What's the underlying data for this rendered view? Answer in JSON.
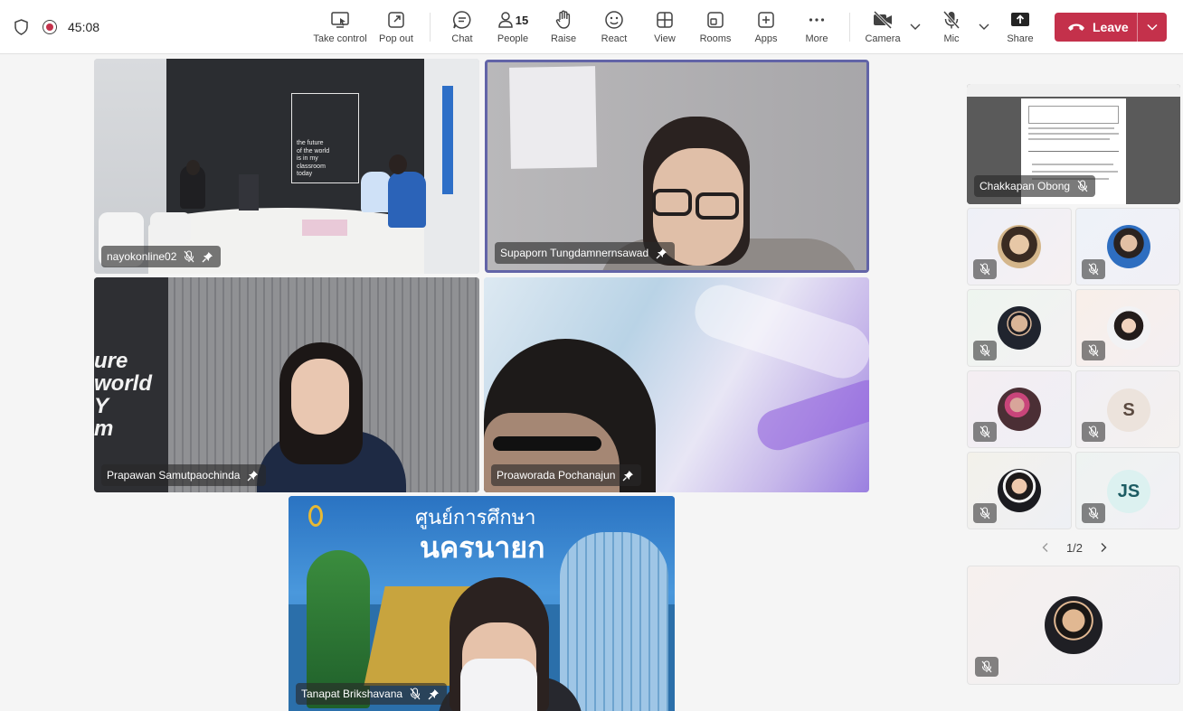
{
  "meeting": {
    "timer": "45:08"
  },
  "toolbar": {
    "take_control": "Take control",
    "pop_out": "Pop out",
    "chat": "Chat",
    "people": "People",
    "people_count": "15",
    "raise": "Raise",
    "react": "React",
    "view": "View",
    "rooms": "Rooms",
    "apps": "Apps",
    "more": "More",
    "camera": "Camera",
    "mic": "Mic",
    "share": "Share",
    "leave": "Leave"
  },
  "tiles": [
    {
      "name": "nayokonline02",
      "muted": true,
      "pinned": true
    },
    {
      "name": "Supaporn Tungdamnernsawad",
      "muted": false,
      "pinned": true,
      "active_speaker": true
    },
    {
      "name": "Prapawan Samutpaochinda",
      "muted": false,
      "pinned": true
    },
    {
      "name": "Proaworada Pochanajun",
      "muted": false,
      "pinned": true
    },
    {
      "name": "Tanapat Brikshavana",
      "muted": true,
      "pinned": true
    }
  ],
  "scene_text": {
    "wall_poster": [
      "the future",
      "of the world",
      "is in my",
      "classroom",
      "today"
    ],
    "wall_sign": [
      "ure",
      "world",
      "Y",
      "m"
    ],
    "banner_thai_top": "ศูนย์การศึกษา",
    "banner_thai_bottom": "นครนายก"
  },
  "side_panel": {
    "screen_share_name": "Chakkapan Obong",
    "grid": [
      {
        "kind": "photo"
      },
      {
        "kind": "photo"
      },
      {
        "kind": "photo"
      },
      {
        "kind": "photo"
      },
      {
        "kind": "photo"
      },
      {
        "kind": "initials",
        "initials": "S"
      },
      {
        "kind": "photo"
      },
      {
        "kind": "initials",
        "initials": "JS"
      }
    ],
    "page_indicator": "1/2"
  },
  "colors": {
    "leave": "#c4314b",
    "active_border": "#6264a7",
    "record": "#c4314b"
  }
}
